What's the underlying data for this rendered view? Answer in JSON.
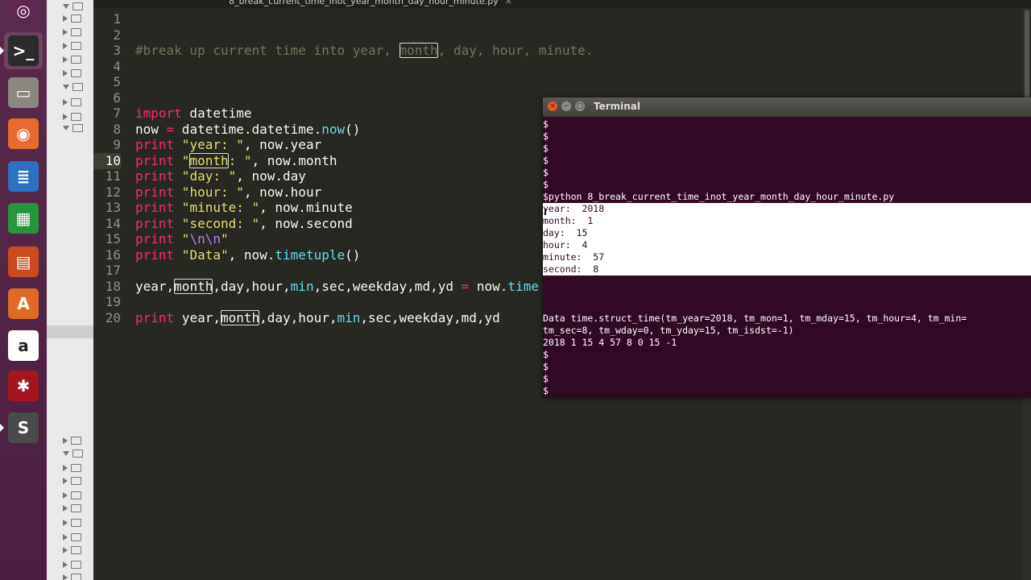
{
  "launcher": {
    "items": [
      {
        "name": "dash-icon",
        "glyph": "◎",
        "color": "#5e2750"
      },
      {
        "name": "terminal-icon",
        "glyph": ">_",
        "color": "#2b2b2b"
      },
      {
        "name": "files-icon",
        "glyph": "▭",
        "color": "#8a8680"
      },
      {
        "name": "firefox-icon",
        "glyph": "◉",
        "color": "#e8692d"
      },
      {
        "name": "writer-icon",
        "glyph": "≣",
        "color": "#2a71c2"
      },
      {
        "name": "calc-icon",
        "glyph": "▦",
        "color": "#27943f"
      },
      {
        "name": "impress-icon",
        "glyph": "▤",
        "color": "#cc4a1f"
      },
      {
        "name": "software-center-icon",
        "glyph": "A",
        "color": "#e06a24"
      },
      {
        "name": "amazon-icon",
        "glyph": "a",
        "color": "#ffffff"
      },
      {
        "name": "system-settings-icon",
        "glyph": "✱",
        "color": "#a3161f"
      },
      {
        "name": "sublime-text-icon",
        "glyph": "S",
        "color": "#4a4a4a"
      }
    ]
  },
  "tab": {
    "label": "8_break_current_time_inot_year_month_day_hour_minute.py",
    "close": "×"
  },
  "editor": {
    "line_numbers": [
      "1",
      "2",
      "3",
      "4",
      "5",
      "6",
      "7",
      "8",
      "9",
      "10",
      "11",
      "12",
      "13",
      "14",
      "15",
      "16",
      "17",
      "18",
      "19",
      "20"
    ],
    "current_line": "10",
    "line3": {
      "a": "#break up current time into year, ",
      "b": "month",
      ", day, hour, minute.": "",
      "c": ", day, hour, minute."
    },
    "line7": {
      "kw": "import",
      "rest": " datetime"
    },
    "line8": {
      "a": "now ",
      "op": "=",
      "b": " datetime.datetime.",
      "fn": "now",
      "c": "()"
    },
    "line9": {
      "kw": "print",
      "str": " \"year: \"",
      "rest": ", now.year"
    },
    "line10": {
      "kw": "print",
      "q1": " \"",
      "hl": "month",
      "q2": ": \"",
      "rest": ", now.month"
    },
    "line11": {
      "kw": "print",
      "str": " \"day: \"",
      "rest": ", now.day"
    },
    "line12": {
      "kw": "print",
      "str": " \"hour: \"",
      "rest": ", now.hour"
    },
    "line13": {
      "kw": "print",
      "str": " \"minute: \"",
      "rest": ", now.minute"
    },
    "line14": {
      "kw": "print",
      "str": " \"second: \"",
      "rest": ", now.second"
    },
    "line15": {
      "kw": "print",
      "q1": " \"",
      "esc": "\\n\\n",
      "q2": "\""
    },
    "line16": {
      "kw": "print",
      "str": " \"Data\"",
      "a": ", now.",
      "fn": "timetuple",
      "b": "()"
    },
    "line18": {
      "a": "year,",
      "hl": "month",
      "b": ",day,hour,",
      "fn": "min",
      "c": ",sec,weekday,md,yd ",
      "op": "=",
      "d": " now.",
      "fn2": "time"
    },
    "line20": {
      "kw": "print",
      "a": " year,",
      "hl": "month",
      "b": ",day,hour,",
      "fn": "min",
      "c": ",sec,weekday,md,yd"
    }
  },
  "terminal": {
    "title": "Terminal",
    "close": "×",
    "minimize": "−",
    "maximize": "□",
    "lines_before": [
      "$",
      "$",
      "$",
      "$",
      "$",
      "$"
    ],
    "command": "$python 8_break_current_time_inot_year_month_day_hour_minute.py",
    "selected_lines": [
      "year:  2018",
      "month:  1",
      "day:  15",
      "hour:  4",
      "minute:  57",
      "second:  8"
    ],
    "data_line1": "Data time.struct_time(tm_year=2018, tm_mon=1, tm_mday=15, tm_hour=4, tm_min=",
    "data_line2": "tm_sec=8, tm_wday=0, tm_yday=15, tm_isdst=-1)",
    "tuple_line": "2018 1 15 4 57 8 0 15 -1",
    "lines_after": [
      "$",
      "$",
      "$",
      "$"
    ]
  }
}
